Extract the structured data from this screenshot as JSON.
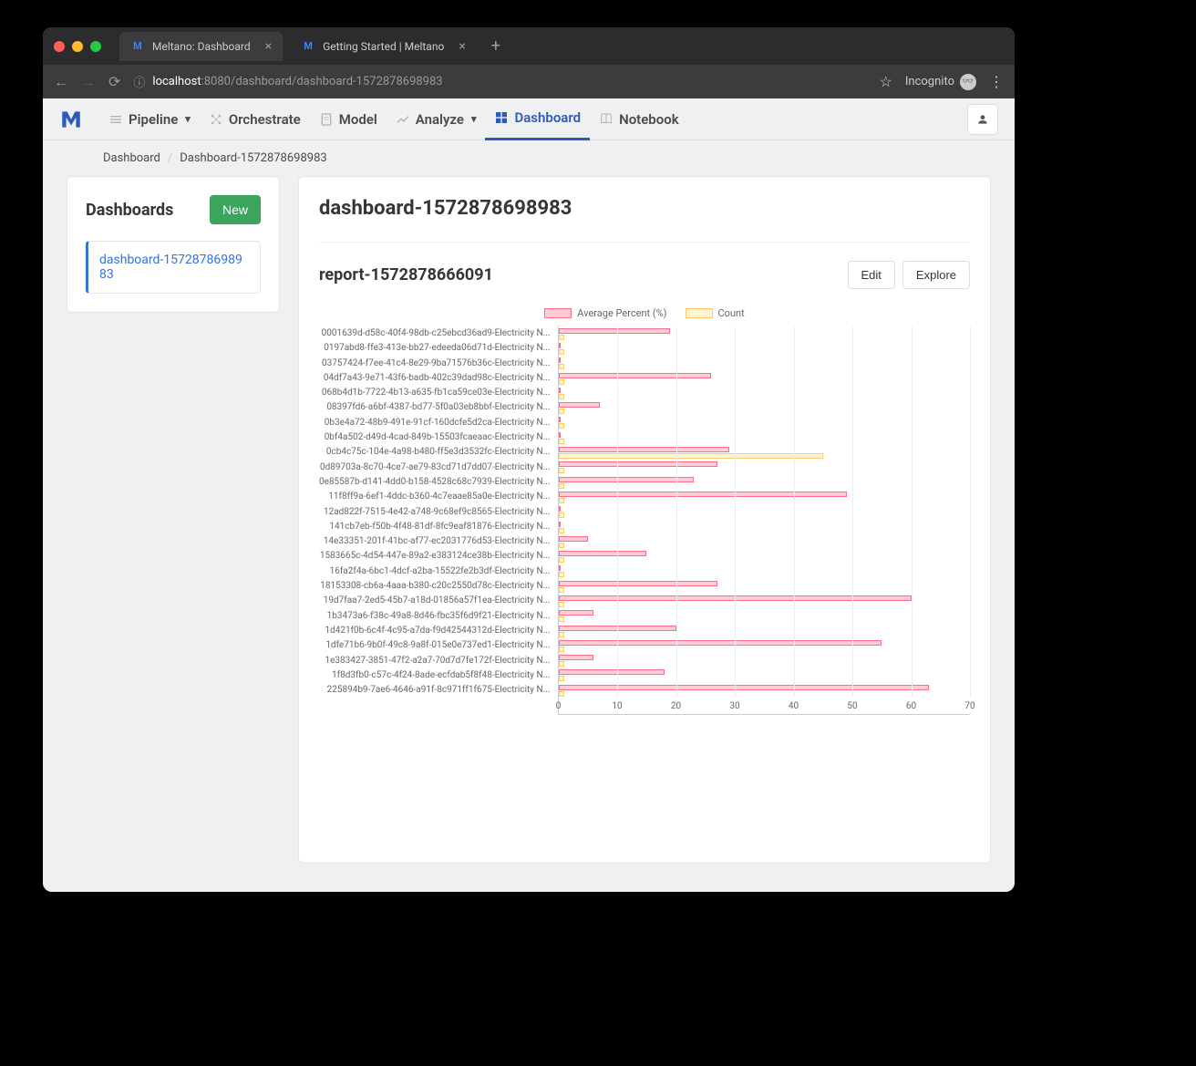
{
  "browser": {
    "tabs": [
      {
        "title": "Meltano: Dashboard",
        "active": true
      },
      {
        "title": "Getting Started | Meltano",
        "active": false
      }
    ],
    "url_host": "localhost",
    "url_port_path": ":8080/dashboard/dashboard-1572878698983",
    "incognito_label": "Incognito"
  },
  "nav": {
    "items": [
      {
        "label": "Pipeline",
        "dropdown": true
      },
      {
        "label": "Orchestrate"
      },
      {
        "label": "Model"
      },
      {
        "label": "Analyze",
        "dropdown": true
      },
      {
        "label": "Dashboard",
        "active": true
      },
      {
        "label": "Notebook"
      }
    ]
  },
  "breadcrumb": [
    "Dashboard",
    "Dashboard-1572878698983"
  ],
  "sidebar": {
    "title": "Dashboards",
    "new_label": "New",
    "items": [
      "dashboard-1572878698983"
    ]
  },
  "dashboard": {
    "title": "dashboard-1572878698983",
    "report_title": "report-1572878666091",
    "edit_label": "Edit",
    "explore_label": "Explore"
  },
  "chart_data": {
    "type": "bar",
    "orientation": "horizontal",
    "legend": [
      "Average Percent (%)",
      "Count"
    ],
    "xlim": [
      0,
      70
    ],
    "xticks": [
      0,
      10,
      20,
      30,
      40,
      50,
      60,
      70
    ],
    "categories": [
      "0001639d-d58c-40f4-98db-c25ebcd36ad9-Electricity N...",
      "0197abd8-ffe3-413e-bb27-edeeda06d71d-Electricity N...",
      "03757424-f7ee-41c4-8e29-9ba71576b36c-Electricity N...",
      "04df7a43-9e71-43f6-badb-402c39dad98c-Electricity N...",
      "068b4d1b-7722-4b13-a635-fb1ca59ce03e-Electricity N...",
      "08397fd6-a6bf-4387-bd77-5f0a03eb8bbf-Electricity N...",
      "0b3e4a72-48b9-491e-91cf-160dcfe5d2ca-Electricity N...",
      "0bf4a502-d49d-4cad-849b-15503fcaeaac-Electricity N...",
      "0cb4c75c-104e-4a98-b480-ff5e3d3532fc-Electricity N...",
      "0d89703a-8c70-4ce7-ae79-83cd71d7dd07-Electricity N...",
      "0e85587b-d141-4dd0-b158-4528c68c7939-Electricity N...",
      "11f8ff9a-6ef1-4ddc-b360-4c7eaae85a0e-Electricity N...",
      "12ad822f-7515-4e42-a748-9c68ef9c8565-Electricity N...",
      "141cb7eb-f50b-4f48-81df-8fc9eaf81876-Electricity N...",
      "14e33351-201f-41bc-af77-ec2031776d53-Electricity N...",
      "1583665c-4d54-447e-89a2-e383124ce38b-Electricity N...",
      "16fa2f4a-6bc1-4dcf-a2ba-15522fe2b3df-Electricity N...",
      "18153308-cb6a-4aaa-b380-c20c2550d78c-Electricity N...",
      "19d7faa7-2ed5-45b7-a18d-01856a57f1ea-Electricity N...",
      "1b3473a6-f38c-49a8-8d46-fbc35f6d9f21-Electricity N...",
      "1d421f0b-6c4f-4c95-a7da-f9d42544312d-Electricity N...",
      "1dfe71b6-9b0f-49c8-9a8f-015e0e737ed1-Electricity N...",
      "1e383427-3851-47f2-a2a7-70d7d7fe172f-Electricity N...",
      "1f8d3fb0-c57c-4f24-8ade-ecfdab5f8f48-Electricity N...",
      "225894b9-7ae6-4646-a91f-8c971ff1f675-Electricity N..."
    ],
    "series": [
      {
        "name": "Average Percent (%)",
        "color": "#ffccd5",
        "values": [
          19,
          0,
          0,
          26,
          0,
          7,
          0,
          0,
          29,
          27,
          23,
          49,
          0,
          0,
          5,
          15,
          0,
          27,
          60,
          6,
          20,
          55,
          6,
          18,
          63
        ]
      },
      {
        "name": "Count",
        "color": "#fff3d6",
        "values": [
          1,
          1,
          1,
          1,
          1,
          1,
          1,
          1,
          45,
          1,
          1,
          1,
          1,
          1,
          1,
          1,
          1,
          1,
          1,
          1,
          1,
          1,
          1,
          1,
          1
        ]
      }
    ]
  }
}
